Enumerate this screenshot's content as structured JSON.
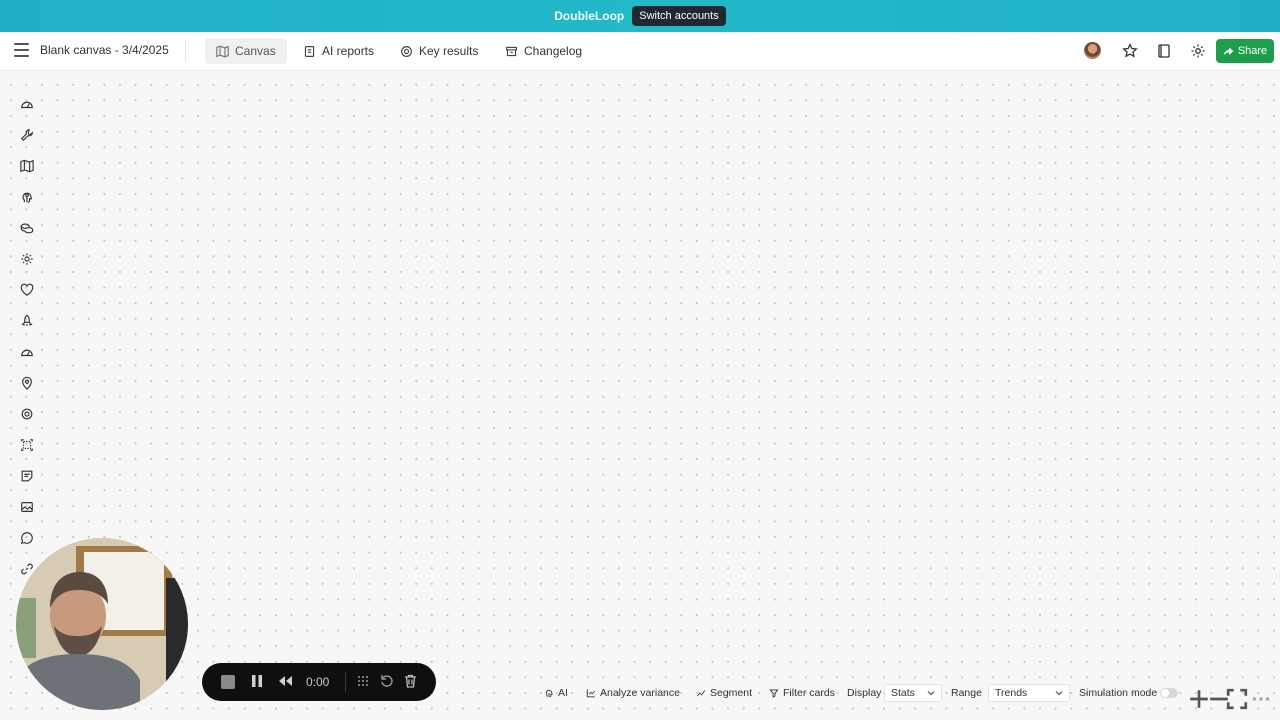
{
  "banner": {
    "brand": "DoubleLoop",
    "switch_label": "Switch accounts"
  },
  "header": {
    "title": "Blank canvas - 3/4/2025",
    "tabs": [
      {
        "label": "Canvas",
        "icon": "map-icon",
        "active": true
      },
      {
        "label": "AI reports",
        "icon": "report-icon",
        "active": false
      },
      {
        "label": "Key results",
        "icon": "target-icon",
        "active": false
      },
      {
        "label": "Changelog",
        "icon": "archive-icon",
        "active": false
      }
    ],
    "share_label": "Share"
  },
  "toolrail": {
    "tools": [
      "gauge-icon",
      "wrench-icon",
      "map-icon",
      "brain-icon",
      "coins-icon",
      "gear-icon",
      "heart-icon",
      "rocket-icon",
      "gauge-icon",
      "location-pin-icon",
      "target-icon",
      "selection-frame-icon",
      "sticky-note-icon",
      "image-icon",
      "comment-icon",
      "link-icon"
    ]
  },
  "recorder": {
    "time": "0:00"
  },
  "bottombar": {
    "ai_label": "AI",
    "analyze_label": "Analyze variance",
    "segment_label": "Segment",
    "filter_label": "Filter cards",
    "display_label": "Display",
    "display_value": "Stats",
    "range_label": "Range",
    "range_value": "Trends",
    "simulation_label": "Simulation mode",
    "simulation_on": false
  },
  "colors": {
    "banner": "#23b9c9",
    "share": "#1e9e4a",
    "recorder": "#0f0f10"
  }
}
